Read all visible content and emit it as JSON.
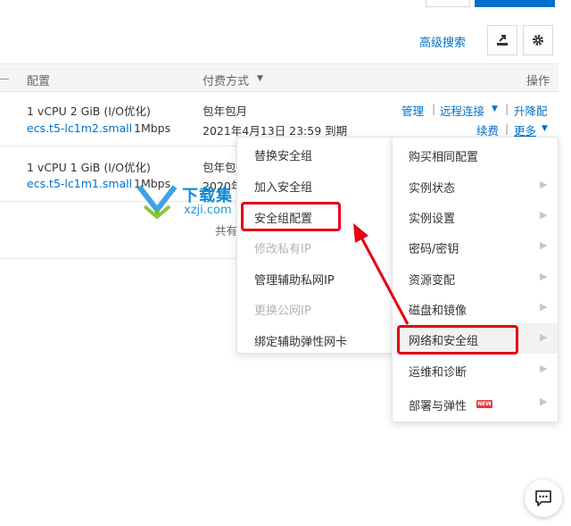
{
  "toolbar": {
    "advanced_search": "高级搜索"
  },
  "table": {
    "headers": {
      "config": "配置",
      "payment": "付费方式",
      "ops": "操作"
    },
    "rows": [
      {
        "spec": "1 vCPU 2 GiB (I/O优化)",
        "type": "ecs.t5-lc1m2.small",
        "bandwidth": "1Mbps",
        "payment": "包年包月",
        "expiry": "2021年4月13日 23:59 到期",
        "ops": {
          "manage": "管理",
          "remote": "远程连接",
          "upgrade": "升降配",
          "renew": "续费",
          "more": "更多"
        }
      },
      {
        "spec": "1 vCPU 1 GiB (I/O优化)",
        "type": "ecs.t5-lc1m1.small",
        "bandwidth": "1Mbps",
        "payment": "包年包",
        "expiry": "2020年"
      }
    ],
    "total_prefix": "共有"
  },
  "watermark": {
    "title": "下载集",
    "site": "xzji.com"
  },
  "submenu": {
    "items": [
      {
        "label": "替换安全组",
        "disabled": false
      },
      {
        "label": "加入安全组",
        "disabled": false
      },
      {
        "label": "安全组配置",
        "disabled": false
      },
      {
        "label": "修改私有IP",
        "disabled": true
      },
      {
        "label": "管理辅助私网IP",
        "disabled": false
      },
      {
        "label": "更换公网IP",
        "disabled": true
      },
      {
        "label": "绑定辅助弹性网卡",
        "disabled": false
      }
    ]
  },
  "menu": {
    "items": [
      {
        "label": "购买相同配置"
      },
      {
        "label": "实例状态"
      },
      {
        "label": "实例设置"
      },
      {
        "label": "密码/密钥"
      },
      {
        "label": "资源变配"
      },
      {
        "label": "磁盘和镜像"
      },
      {
        "label": "网络和安全组"
      },
      {
        "label": "运维和诊断"
      },
      {
        "label": "部署与弹性"
      }
    ],
    "new_badge": "NEW"
  },
  "colors": {
    "link": "#0070cc",
    "highlight_box": "#e60012",
    "arrow": "#e60012"
  }
}
